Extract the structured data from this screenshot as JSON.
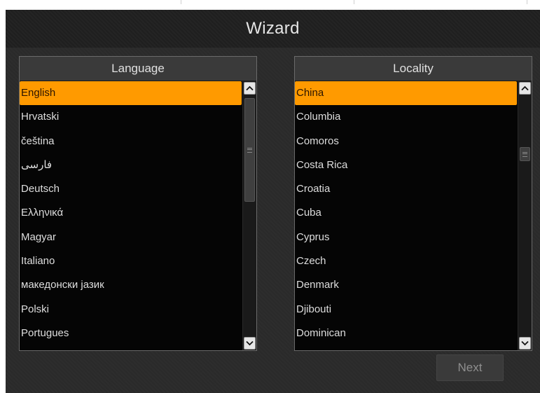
{
  "window": {
    "title": "Wizard"
  },
  "language_panel": {
    "header": "Language",
    "items": [
      "English",
      "Hrvatski",
      "čeština",
      "فارسی",
      "Deutsch",
      "Ελληνικά",
      "Magyar",
      "Italiano",
      "македонски јазик",
      "Polski",
      "Portugues"
    ],
    "selected": "English",
    "scrollbar": {
      "up_icon": "chevron-up-icon",
      "down_icon": "chevron-down-icon",
      "scroll_fraction": 0.0
    }
  },
  "locality_panel": {
    "header": "Locality",
    "items": [
      "China",
      "Columbia",
      "Comoros",
      "Costa Rica",
      "Croatia",
      "Cuba",
      "Cyprus",
      "Czech",
      "Denmark",
      "Djibouti",
      "Dominican"
    ],
    "selected": "China",
    "scrollbar": {
      "up_icon": "chevron-up-icon",
      "down_icon": "chevron-down-icon",
      "scroll_fraction": 0.22
    }
  },
  "footer": {
    "next_label": "Next"
  },
  "colors": {
    "accent": "#ff9a00",
    "background": "#2b2b2b",
    "list_background": "#050505"
  }
}
